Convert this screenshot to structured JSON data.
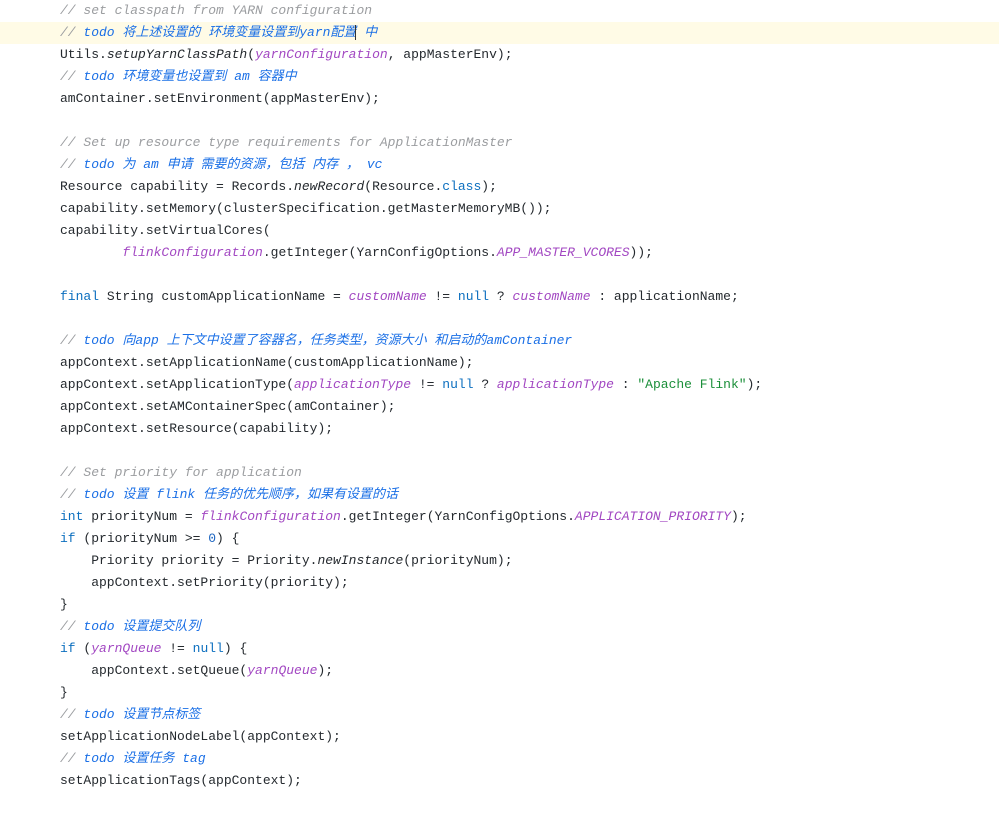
{
  "code": {
    "l1_a": "// set classpath from YARN configuration",
    "l2_a": "// ",
    "l2_b": "todo 将上述设置的 环境变量设置到yarn配置",
    "l2_c": " 中",
    "l3_a": "Utils.",
    "l3_b": "setupYarnClassPath",
    "l3_c": "(",
    "l3_d": "yarnConfiguration",
    "l3_e": ", appMasterEnv);",
    "l4_a": "// ",
    "l4_b": "todo 环境变量也设置到 am 容器中",
    "l5_a": "amContainer.setEnvironment(appMasterEnv);",
    "l7_a": "// Set up resource type requirements for ApplicationMaster",
    "l8_a": "// ",
    "l8_b": "todo 为 am 申请 需要的资源，包括 内存 ， vc",
    "l9_a": "Resource capability = Records.",
    "l9_b": "newRecord",
    "l9_c": "(Resource.",
    "l9_d": "class",
    "l9_e": ");",
    "l10_a": "capability.setMemory(clusterSpecification.getMasterMemoryMB());",
    "l11_a": "capability.setVirtualCores(",
    "l12_a": "        ",
    "l12_b": "flinkConfiguration",
    "l12_c": ".getInteger(YarnConfigOptions.",
    "l12_d": "APP_MASTER_VCORES",
    "l12_e": "));",
    "l14_a": "final",
    "l14_b": " String customApplicationName = ",
    "l14_c": "customName",
    "l14_d": " != ",
    "l14_e": "null",
    "l14_f": " ? ",
    "l14_g": "customName",
    "l14_h": " : applicationName;",
    "l16_a": "// ",
    "l16_b": "todo 向app 上下文中设置了容器名，任务类型，资源大小 和启动的amContainer",
    "l17_a": "appContext.setApplicationName(customApplicationName);",
    "l18_a": "appContext.setApplicationType(",
    "l18_b": "applicationType",
    "l18_c": " != ",
    "l18_d": "null",
    "l18_e": " ? ",
    "l18_f": "applicationType",
    "l18_g": " : ",
    "l18_h": "\"Apache Flink\"",
    "l18_i": ");",
    "l19_a": "appContext.setAMContainerSpec(amContainer);",
    "l20_a": "appContext.setResource(capability);",
    "l22_a": "// Set priority for application",
    "l23_a": "// ",
    "l23_b": "todo 设置 flink 任务的优先顺序，如果有设置的话",
    "l24_a": "int",
    "l24_b": " priorityNum = ",
    "l24_c": "flinkConfiguration",
    "l24_d": ".getInteger(YarnConfigOptions.",
    "l24_e": "APPLICATION_PRIORITY",
    "l24_f": ");",
    "l25_a": "if",
    "l25_b": " (priorityNum >= ",
    "l25_c": "0",
    "l25_d": ") {",
    "l26_a": "    Priority priority = Priority.",
    "l26_b": "newInstance",
    "l26_c": "(priorityNum);",
    "l27_a": "    appContext.setPriority(priority);",
    "l28_a": "}",
    "l29_a": "// ",
    "l29_b": "todo 设置提交队列",
    "l30_a": "if",
    "l30_b": " (",
    "l30_c": "yarnQueue",
    "l30_d": " != ",
    "l30_e": "null",
    "l30_f": ") {",
    "l31_a": "    appContext.setQueue(",
    "l31_b": "yarnQueue",
    "l31_c": ");",
    "l32_a": "}",
    "l33_a": "// ",
    "l33_b": "todo 设置节点标签",
    "l34_a": "setApplicationNodeLabel(appContext);",
    "l35_a": "// ",
    "l35_b": "todo 设置任务 tag",
    "l36_a": "setApplicationTags(appContext);"
  }
}
